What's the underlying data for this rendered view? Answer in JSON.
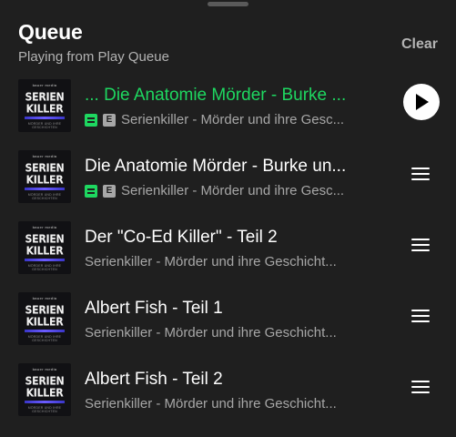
{
  "header": {
    "title": "Queue",
    "subtitle": "Playing from Play Queue",
    "clear_label": "Clear"
  },
  "cover_art": {
    "brand": "bauer media",
    "line1": "SERIEN",
    "line2": "KILLER",
    "tagline": "MÖRDER UND IHRE GESCHICHTEN"
  },
  "colors": {
    "background": "#1f1f1f",
    "accent_green": "#1ed760",
    "text_secondary": "#a7a7a7"
  },
  "tracks": [
    {
      "title": "... Die Anatomie Mörder - Burke ...",
      "subtitle": "Serienkiller - Mörder und ihre Gesc...",
      "playing": true,
      "downloaded": true,
      "explicit": true,
      "explicit_label": "E",
      "action_icon": "play-icon"
    },
    {
      "title": "Die Anatomie Mörder - Burke un...",
      "subtitle": "Serienkiller - Mörder und ihre Gesc...",
      "playing": false,
      "downloaded": true,
      "explicit": true,
      "explicit_label": "E",
      "action_icon": "drag-handle-icon"
    },
    {
      "title": "Der \"Co-Ed Killer\" - Teil 2",
      "subtitle": "Serienkiller - Mörder und ihre Geschicht...",
      "playing": false,
      "downloaded": false,
      "explicit": false,
      "action_icon": "drag-handle-icon"
    },
    {
      "title": "Albert Fish - Teil 1",
      "subtitle": "Serienkiller - Mörder und ihre Geschicht...",
      "playing": false,
      "downloaded": false,
      "explicit": false,
      "action_icon": "drag-handle-icon"
    },
    {
      "title": "Albert Fish - Teil 2",
      "subtitle": "Serienkiller - Mörder und ihre Geschicht...",
      "playing": false,
      "downloaded": false,
      "explicit": false,
      "action_icon": "drag-handle-icon"
    }
  ]
}
